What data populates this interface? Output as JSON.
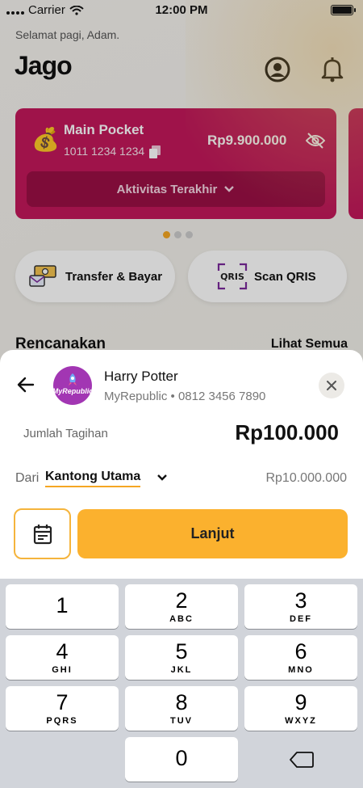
{
  "status_bar": {
    "carrier": "Carrier",
    "time": "12:00 PM"
  },
  "home": {
    "greeting": "Selamat pagi, Adam.",
    "logo_text": "Jago",
    "pocket": {
      "name": "Main Pocket",
      "account_number": "1011 1234 1234",
      "balance": "Rp9.900.000",
      "activity_label": "Aktivitas Terakhir",
      "color": "#c2185b"
    },
    "carousel": {
      "active_index": 0,
      "count": 3
    },
    "quick_actions": [
      {
        "label": "Transfer & Bayar",
        "icon": "transfer-money-icon"
      },
      {
        "label": "Scan QRIS",
        "icon": "qris-icon"
      }
    ],
    "section": {
      "title": "Rencanakan",
      "see_all": "Lihat Semua"
    }
  },
  "sheet": {
    "payee": {
      "name": "Harry Potter",
      "provider": "MyRepublic",
      "subtitle": "MyRepublic • 0812 3456 7890",
      "avatar_color": "#a236b3"
    },
    "bill_label": "Jumlah Tagihan",
    "bill_amount": "Rp100.000",
    "from_label": "Dari",
    "from_pocket": "Kantong Utama",
    "from_balance": "Rp10.000.000",
    "next_label": "Lanjut",
    "accent_color": "#fbb12e"
  },
  "keypad": {
    "keys": [
      {
        "num": "1",
        "letters": ""
      },
      {
        "num": "2",
        "letters": "ABC"
      },
      {
        "num": "3",
        "letters": "DEF"
      },
      {
        "num": "4",
        "letters": "GHI"
      },
      {
        "num": "5",
        "letters": "JKL"
      },
      {
        "num": "6",
        "letters": "MNO"
      },
      {
        "num": "7",
        "letters": "PQRS"
      },
      {
        "num": "8",
        "letters": "TUV"
      },
      {
        "num": "9",
        "letters": "WXYZ"
      },
      {
        "num": "0",
        "letters": ""
      }
    ]
  }
}
